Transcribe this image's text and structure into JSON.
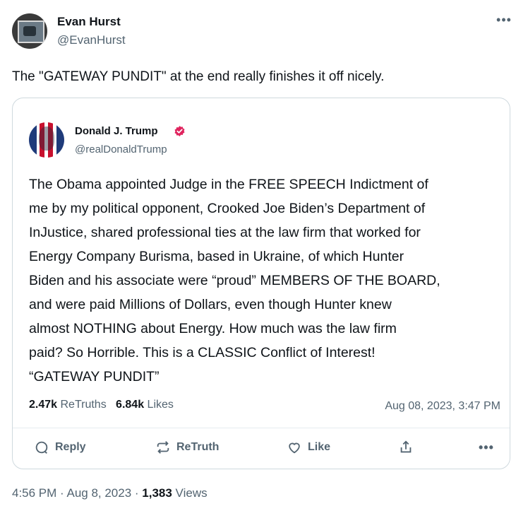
{
  "author": {
    "name": "Evan Hurst",
    "handle": "@EvanHurst"
  },
  "tweet": {
    "text": "The \"GATEWAY PUNDIT\" at the end really finishes it off nicely."
  },
  "quoted": {
    "name": "Donald J. Trump",
    "handle": "@realDonaldTrump",
    "body": "The Obama appointed Judge in  the FREE SPEECH Indictment of\nme by my political opponent, Crooked Joe Biden’s Department of\nInJustice, shared professional ties at the law firm that worked for\nEnergy Company Burisma, based in Ukraine, of which Hunter\nBiden and his associate were “proud” MEMBERS OF THE BOARD,\nand were paid Millions of Dollars, even though Hunter knew\nalmost NOTHING about Energy. How much was the law firm\npaid? So Horrible. This is a CLASSIC Conflict of Interest!\n“GATEWAY PUNDIT”",
    "retruths_count": "2.47k",
    "retruths_label": "ReTruths",
    "likes_count": "6.84k",
    "likes_label": "Likes",
    "date": "Aug 08, 2023, 3:47 PM",
    "actions": {
      "reply": "Reply",
      "retruth": "ReTruth",
      "like": "Like"
    }
  },
  "footer": {
    "time": "4:56 PM · Aug 8, 2023 · ",
    "views_count": "1,383",
    "views_label": " Views"
  },
  "colors": {
    "text": "#0f1419",
    "muted": "#536471",
    "border": "#cfd9de",
    "verified": "#e0245e"
  }
}
